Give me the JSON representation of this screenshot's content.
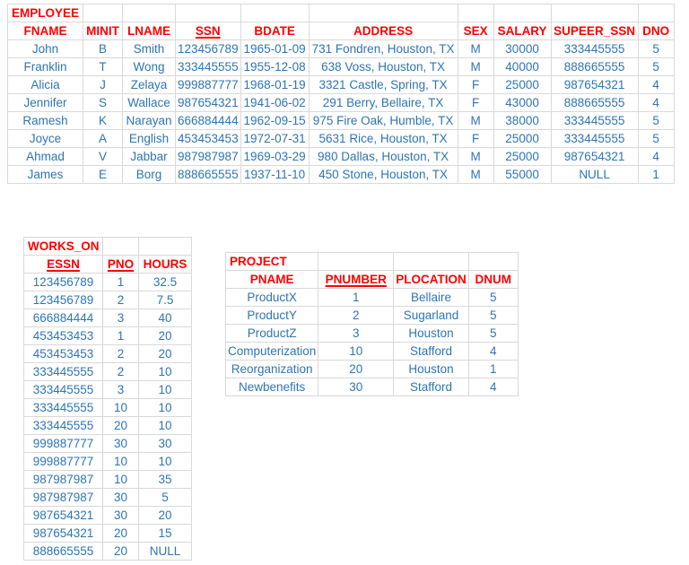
{
  "colors": {
    "header": "#ff0000",
    "cell": "#2e75b6",
    "border": "#d9d9d9"
  },
  "employee": {
    "title": "EMPLOYEE",
    "columns": [
      "FNAME",
      "MINIT",
      "LNAME",
      "SSN",
      "BDATE",
      "ADDRESS",
      "SEX",
      "SALARY",
      "SUPEER_SSN",
      "DNO"
    ],
    "primary_key": [
      "SSN"
    ],
    "rows": [
      [
        "John",
        "B",
        "Smith",
        "123456789",
        "1965-01-09",
        "731 Fondren, Houston, TX",
        "M",
        "30000",
        "333445555",
        "5"
      ],
      [
        "Franklin",
        "T",
        "Wong",
        "333445555",
        "1955-12-08",
        "638 Voss, Houston, TX",
        "M",
        "40000",
        "888665555",
        "5"
      ],
      [
        "Alicia",
        "J",
        "Zelaya",
        "999887777",
        "1968-01-19",
        "3321 Castle, Spring, TX",
        "F",
        "25000",
        "987654321",
        "4"
      ],
      [
        "Jennifer",
        "S",
        "Wallace",
        "987654321",
        "1941-06-02",
        "291 Berry, Bellaire, TX",
        "F",
        "43000",
        "888665555",
        "4"
      ],
      [
        "Ramesh",
        "K",
        "Narayan",
        "666884444",
        "1962-09-15",
        "975 Fire Oak, Humble, TX",
        "M",
        "38000",
        "333445555",
        "5"
      ],
      [
        "Joyce",
        "A",
        "English",
        "453453453",
        "1972-07-31",
        "5631 Rice, Houston, TX",
        "F",
        "25000",
        "333445555",
        "5"
      ],
      [
        "Ahmad",
        "V",
        "Jabbar",
        "987987987",
        "1969-03-29",
        "980 Dallas, Houston, TX",
        "M",
        "25000",
        "987654321",
        "4"
      ],
      [
        "James",
        "E",
        "Borg",
        "888665555",
        "1937-11-10",
        "450 Stone, Houston, TX",
        "M",
        "55000",
        "NULL",
        "1"
      ]
    ]
  },
  "works_on": {
    "title": "WORKS_ON",
    "columns": [
      "ESSN",
      "PNO",
      "HOURS"
    ],
    "primary_key": [
      "ESSN",
      "PNO"
    ],
    "rows": [
      [
        "123456789",
        "1",
        "32.5"
      ],
      [
        "123456789",
        "2",
        "7.5"
      ],
      [
        "666884444",
        "3",
        "40"
      ],
      [
        "453453453",
        "1",
        "20"
      ],
      [
        "453453453",
        "2",
        "20"
      ],
      [
        "333445555",
        "2",
        "10"
      ],
      [
        "333445555",
        "3",
        "10"
      ],
      [
        "333445555",
        "10",
        "10"
      ],
      [
        "333445555",
        "20",
        "10"
      ],
      [
        "999887777",
        "30",
        "30"
      ],
      [
        "999887777",
        "10",
        "10"
      ],
      [
        "987987987",
        "10",
        "35"
      ],
      [
        "987987987",
        "30",
        "5"
      ],
      [
        "987654321",
        "30",
        "20"
      ],
      [
        "987654321",
        "20",
        "15"
      ],
      [
        "888665555",
        "20",
        "NULL"
      ]
    ]
  },
  "project": {
    "title": "PROJECT",
    "columns": [
      "PNAME",
      "PNUMBER",
      "PLOCATION",
      "DNUM"
    ],
    "primary_key": [
      "PNUMBER"
    ],
    "rows": [
      [
        "ProductX",
        "1",
        "Bellaire",
        "5"
      ],
      [
        "ProductY",
        "2",
        "Sugarland",
        "5"
      ],
      [
        "ProductZ",
        "3",
        "Houston",
        "5"
      ],
      [
        "Computerization",
        "10",
        "Stafford",
        "4"
      ],
      [
        "Reorganization",
        "20",
        "Houston",
        "1"
      ],
      [
        "Newbenefits",
        "30",
        "Stafford",
        "4"
      ]
    ]
  }
}
